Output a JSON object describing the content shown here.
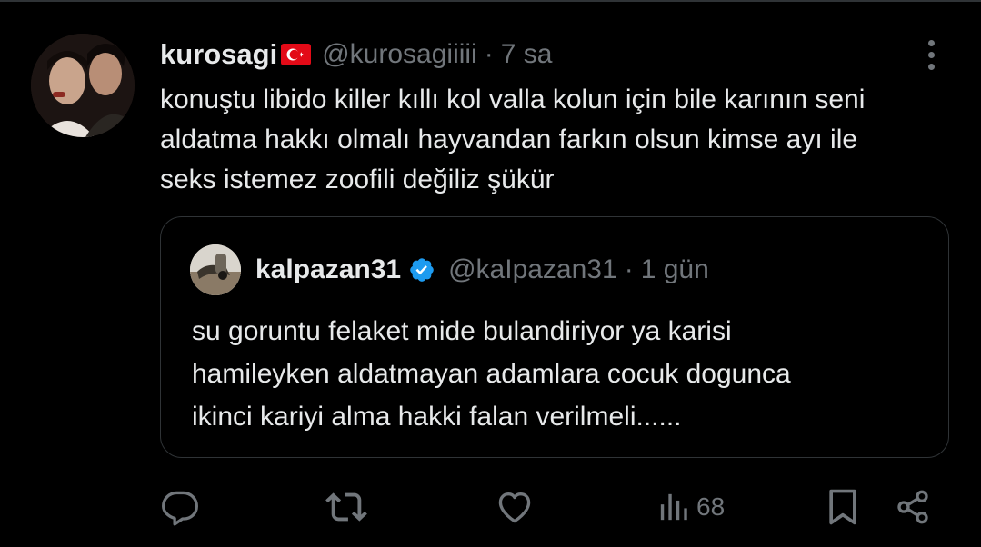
{
  "tweet": {
    "display_name": "kurosagi",
    "flag": "turkey-flag",
    "handle": "@kurosagiiiii",
    "separator": "·",
    "time": "7 sa",
    "text_lines": [
      "konuştu libido killer kıllı kol valla kolun için bile karının seni",
      "aldatma hakkı olmalı hayvandan farkın olsun kimse ayı ile",
      "seks istemez zoofili değiliz şükür"
    ]
  },
  "quote": {
    "display_name": "kalpazan31",
    "verified_icon": "verified-badge-icon",
    "handle": "@kaIpazan31",
    "separator": "·",
    "time": "1 gün",
    "text_lines": [
      "su goruntu felaket mide bulandiriyor ya karisi",
      "hamileyken aldatmayan adamlara cocuk dogunca",
      "ikinci kariyi alma hakki falan verilmeli......"
    ]
  },
  "actions": {
    "reply_icon": "reply-icon",
    "retweet_icon": "retweet-icon",
    "like_icon": "like-icon",
    "views_icon": "views-icon",
    "views_count": "68",
    "bookmark_icon": "bookmark-icon",
    "share_icon": "share-icon"
  },
  "colors": {
    "background": "#000000",
    "text_primary": "#e7e9ea",
    "text_secondary": "#71767b",
    "border": "#2f3336",
    "verified_blue": "#1d9bf0",
    "flag_red": "#e30a17"
  }
}
